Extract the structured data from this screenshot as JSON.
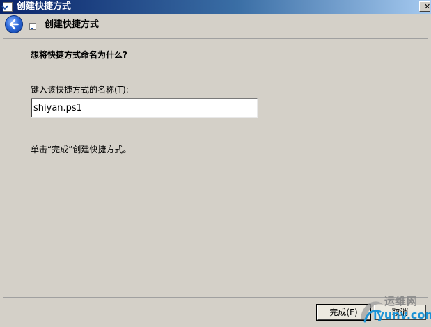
{
  "window": {
    "title": "创建快捷方式",
    "close_label": "✕"
  },
  "header": {
    "title": "创建快捷方式"
  },
  "page": {
    "question": "想将快捷方式命名为什么?",
    "field_label": "键入该快捷方式的名称(T):",
    "name_value": "shiyan.ps1",
    "hint": "单击“完成”创建快捷方式。"
  },
  "footer": {
    "finish_label": "完成(F)",
    "cancel_label": "取消"
  },
  "watermark": {
    "text_cn": "运维网",
    "text_en": "iyunv.com"
  },
  "colors": {
    "titlebar_start": "#0a246a",
    "titlebar_end": "#a6caf0",
    "dialog_bg": "#d4d0c8",
    "watermark_blue": "#1c93d6"
  },
  "icons": {
    "title": "shortcut-icon",
    "back": "back-arrow-icon",
    "close": "close-icon"
  }
}
